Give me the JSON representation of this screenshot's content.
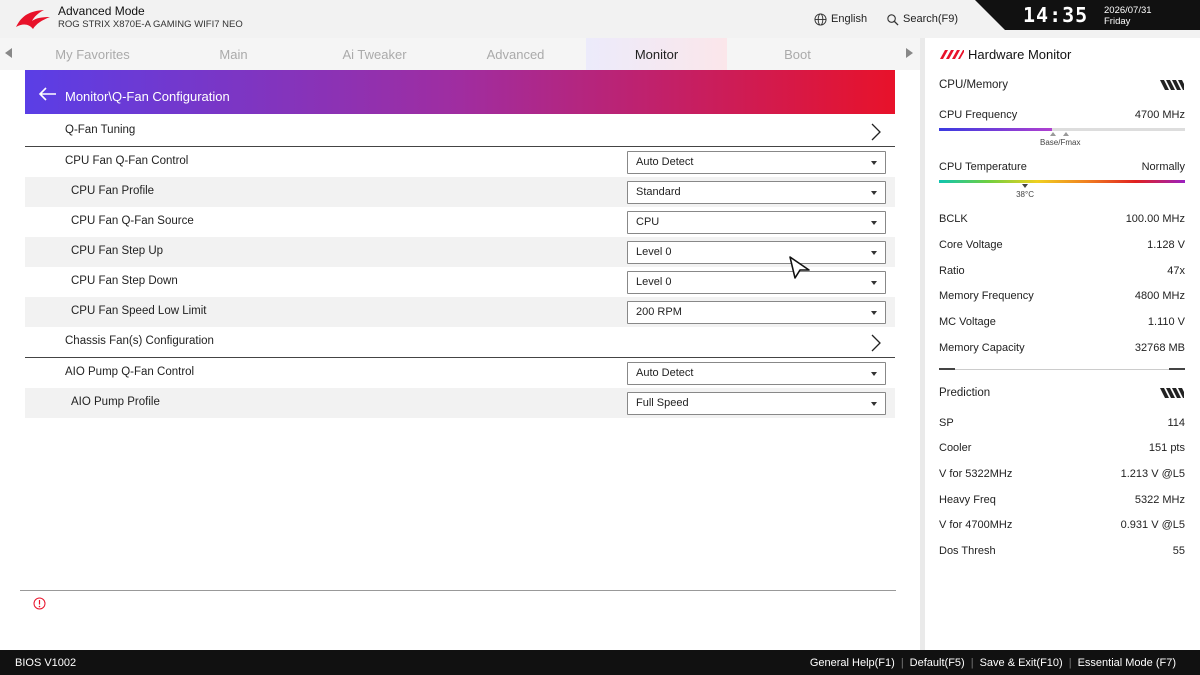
{
  "header": {
    "mode_title": "Advanced Mode",
    "board_name": "ROG STRIX X870E-A GAMING WIFI7 NEO",
    "language_label": "English",
    "search_label": "Search(F9)",
    "time": "14:35",
    "date": "2026/07/31",
    "weekday": "Friday"
  },
  "tabs": [
    {
      "label": "My Favorites",
      "active": false
    },
    {
      "label": "Main",
      "active": false
    },
    {
      "label": "Ai Tweaker",
      "active": false
    },
    {
      "label": "Advanced",
      "active": false
    },
    {
      "label": "Monitor",
      "active": true
    },
    {
      "label": "Boot",
      "active": false
    }
  ],
  "page": {
    "title": "Monitor\\Q-Fan Configuration"
  },
  "settings": [
    {
      "label": "Q-Fan Tuning",
      "kind": "link"
    },
    {
      "label": "CPU Fan Q-Fan Control",
      "kind": "dropdown",
      "value": "Auto Detect"
    },
    {
      "label": "CPU Fan Profile",
      "kind": "dropdown",
      "value": "Standard",
      "sub": true
    },
    {
      "label": "CPU Fan Q-Fan Source",
      "kind": "dropdown",
      "value": "CPU",
      "sub": true
    },
    {
      "label": "CPU Fan Step Up",
      "kind": "dropdown",
      "value": "Level 0",
      "sub": true
    },
    {
      "label": "CPU Fan Step Down",
      "kind": "dropdown",
      "value": "Level 0",
      "sub": true
    },
    {
      "label": "CPU Fan Speed Low Limit",
      "kind": "dropdown",
      "value": "200 RPM",
      "sub": true
    },
    {
      "label": "Chassis Fan(s) Configuration",
      "kind": "link"
    },
    {
      "label": "AIO Pump Q-Fan Control",
      "kind": "dropdown",
      "value": "Auto Detect"
    },
    {
      "label": "AIO Pump Profile",
      "kind": "dropdown",
      "value": "Full Speed",
      "sub": true
    }
  ],
  "hardware_monitor": {
    "title": "Hardware Monitor",
    "cpu_memory_label": "CPU/Memory",
    "cpu_frequency": {
      "label": "CPU Frequency",
      "value": "4700 MHz",
      "fill_fraction": 0.46,
      "marker_label": "Base/Fmax"
    },
    "cpu_temperature": {
      "label": "CPU Temperature",
      "value": "Normally",
      "marker_value": "38°C",
      "marker_fraction": 0.35
    },
    "metrics": [
      {
        "label": "BCLK",
        "value": "100.00 MHz"
      },
      {
        "label": "Core Voltage",
        "value": "1.128 V"
      },
      {
        "label": "Ratio",
        "value": "47x"
      },
      {
        "label": "Memory Frequency",
        "value": "4800 MHz"
      },
      {
        "label": "MC Voltage",
        "value": "1.110 V"
      },
      {
        "label": "Memory Capacity",
        "value": "32768 MB"
      }
    ],
    "prediction_label": "Prediction",
    "prediction": [
      {
        "label": "SP",
        "value": "114"
      },
      {
        "label": "Cooler",
        "value": "151 pts"
      },
      {
        "label": "V for 5322MHz",
        "value": "1.213 V @L5"
      },
      {
        "label": "Heavy Freq",
        "value": "5322 MHz"
      },
      {
        "label": "V for 4700MHz",
        "value": "0.931 V @L5"
      },
      {
        "label": "Dos Thresh",
        "value": "55"
      }
    ]
  },
  "footer": {
    "bios_version": "BIOS V1002",
    "items": [
      "General Help(F1)",
      "Default(F5)",
      "Save & Exit(F10)",
      "Essential Mode (F7)"
    ]
  },
  "colors": {
    "banner_start": "#5a3ee6",
    "banner_end": "#e8122a",
    "rog_red": "#e8122a"
  }
}
